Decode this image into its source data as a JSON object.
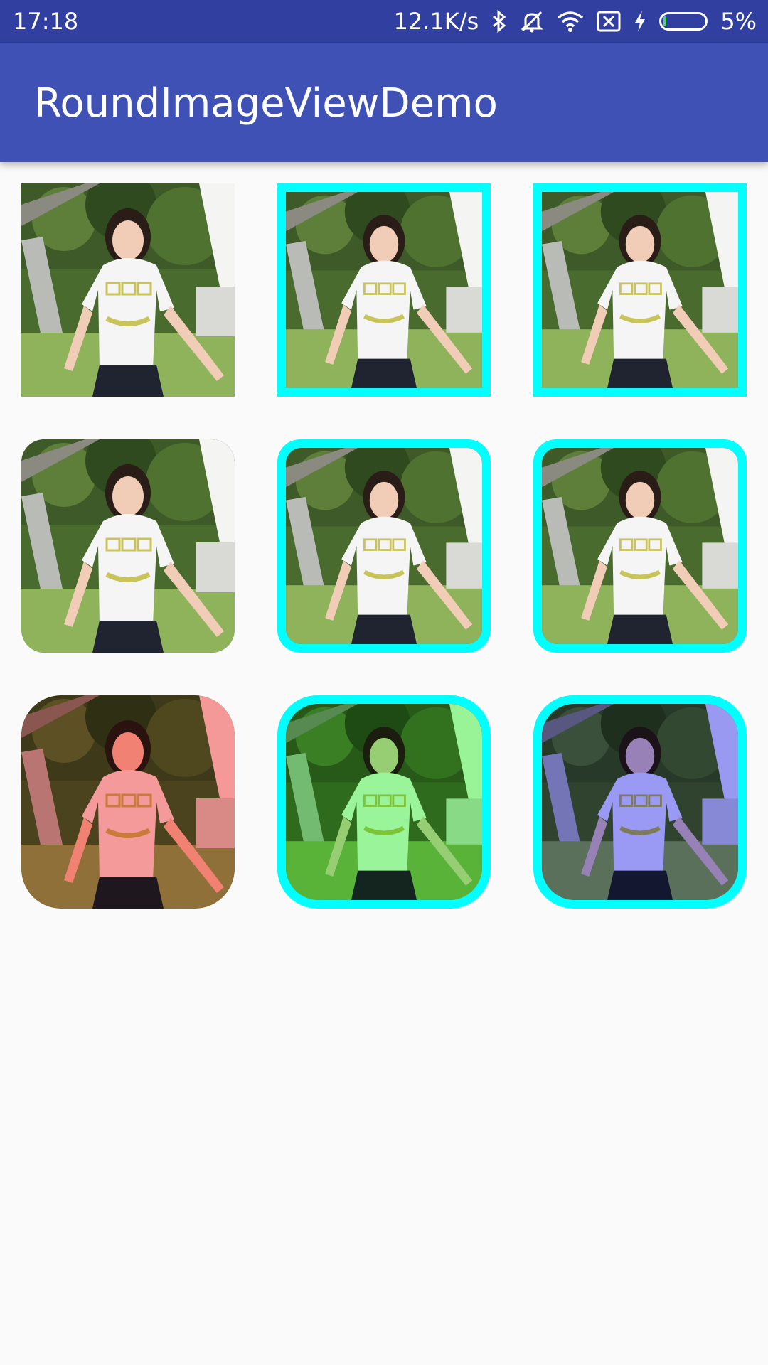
{
  "status_bar": {
    "time": "17:18",
    "network_speed": "12.1K/s",
    "battery_percent": "5%",
    "battery_level": 0.05,
    "icons": [
      "bluetooth-icon",
      "silent-icon",
      "wifi-icon",
      "sim-off-icon",
      "charging-icon",
      "battery-icon"
    ]
  },
  "app_bar": {
    "title": "RoundImageViewDemo",
    "color": "#3f51b5"
  },
  "colors": {
    "border": "#00ffff",
    "tint_red": "#ff8080",
    "tint_green": "#80ff80",
    "tint_blue": "#8080ff"
  },
  "images": [
    {
      "row": 1,
      "col": 1,
      "shape": "square",
      "border": false,
      "tint": "none"
    },
    {
      "row": 1,
      "col": 2,
      "shape": "square",
      "border": true,
      "tint": "none"
    },
    {
      "row": 1,
      "col": 3,
      "shape": "square",
      "border": true,
      "tint": "none"
    },
    {
      "row": 2,
      "col": 1,
      "shape": "rounded-small",
      "border": false,
      "tint": "none"
    },
    {
      "row": 2,
      "col": 2,
      "shape": "rounded-small",
      "border": true,
      "tint": "none"
    },
    {
      "row": 2,
      "col": 3,
      "shape": "rounded-small",
      "border": true,
      "tint": "none"
    },
    {
      "row": 3,
      "col": 1,
      "shape": "rounded-large",
      "border": false,
      "tint": "red"
    },
    {
      "row": 3,
      "col": 2,
      "shape": "rounded-large",
      "border": true,
      "tint": "green"
    },
    {
      "row": 3,
      "col": 3,
      "shape": "rounded-large",
      "border": true,
      "tint": "blue"
    }
  ]
}
